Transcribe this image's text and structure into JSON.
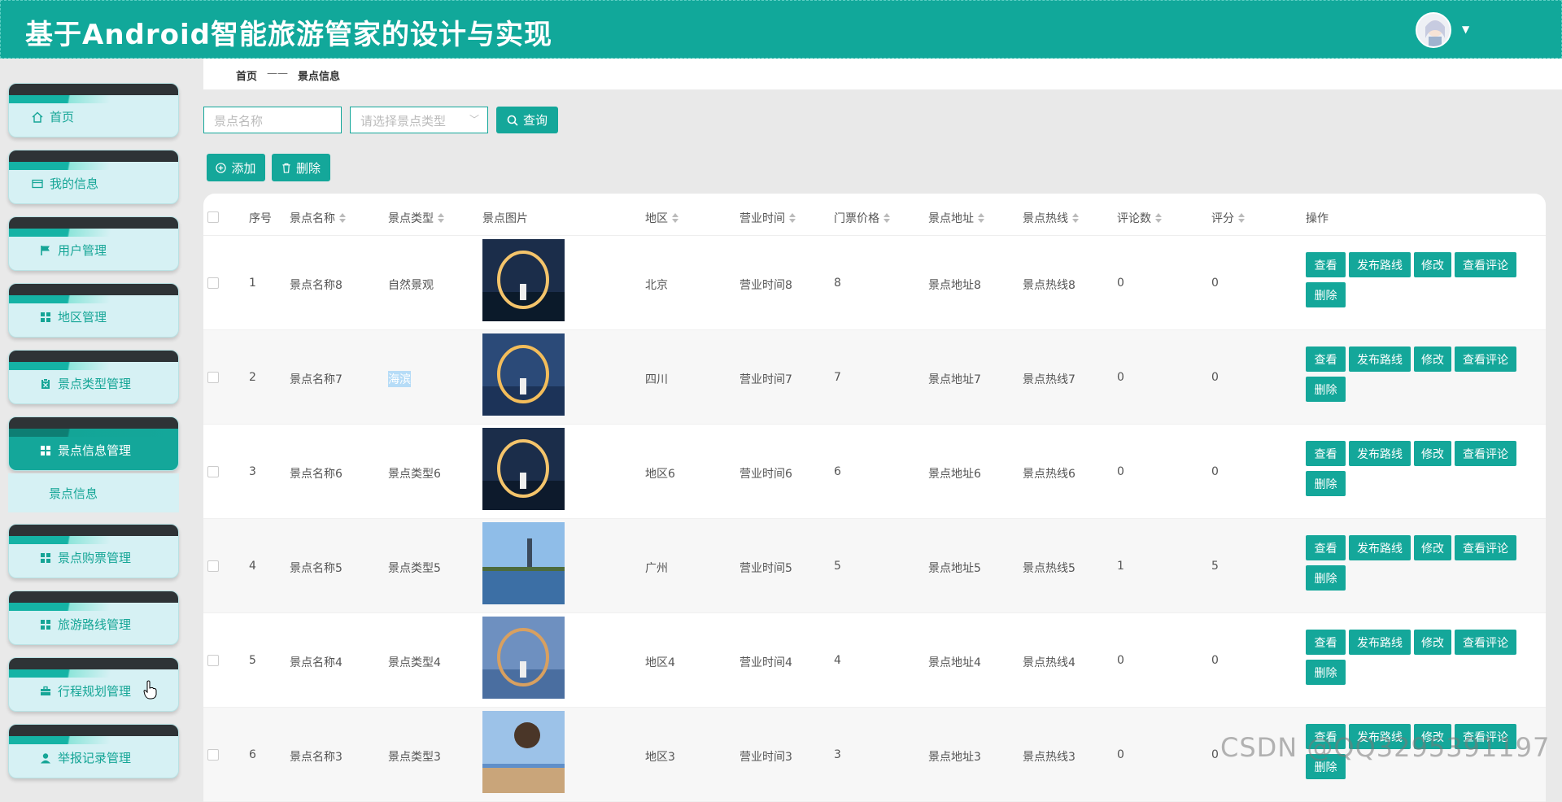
{
  "app": {
    "title": "基于Android智能旅游管家的设计与实现"
  },
  "sidebar": {
    "items": [
      {
        "label": "首页",
        "icon": "home-icon"
      },
      {
        "label": "我的信息",
        "icon": "card-icon"
      },
      {
        "label": "用户管理",
        "icon": "flag-icon"
      },
      {
        "label": "地区管理",
        "icon": "grid-icon"
      },
      {
        "label": "景点类型管理",
        "icon": "clipboard-icon"
      },
      {
        "label": "景点信息管理",
        "icon": "grid-icon"
      },
      {
        "label": "景点购票管理",
        "icon": "grid-icon"
      },
      {
        "label": "旅游路线管理",
        "icon": "grid-icon"
      },
      {
        "label": "行程规划管理",
        "icon": "briefcase-icon"
      },
      {
        "label": "举报记录管理",
        "icon": "user-icon"
      }
    ],
    "sub_item": "景点信息"
  },
  "breadcrumb": {
    "home": "首页",
    "sep": "——",
    "current": "景点信息"
  },
  "search": {
    "name_placeholder": "景点名称",
    "type_placeholder": "请选择景点类型",
    "query_label": "查询"
  },
  "toolbar": {
    "add_label": "添加",
    "delete_label": "删除"
  },
  "table": {
    "headers": [
      "序号",
      "景点名称",
      "景点类型",
      "景点图片",
      "地区",
      "营业时间",
      "门票价格",
      "景点地址",
      "景点热线",
      "评论数",
      "评分",
      "操作"
    ],
    "actions": [
      "查看",
      "发布路线",
      "修改",
      "查看评论",
      "删除"
    ],
    "rows": [
      {
        "no": "1",
        "name": "景点名称8",
        "type": "自然景观",
        "region": "北京",
        "hours": "营业时间8",
        "price": "8",
        "address": "景点地址8",
        "hotline": "景点热线8",
        "comments": "0",
        "score": "0"
      },
      {
        "no": "2",
        "name": "景点名称7",
        "type": "海滨",
        "region": "四川",
        "hours": "营业时间7",
        "price": "7",
        "address": "景点地址7",
        "hotline": "景点热线7",
        "comments": "0",
        "score": "0"
      },
      {
        "no": "3",
        "name": "景点名称6",
        "type": "景点类型6",
        "region": "地区6",
        "hours": "营业时间6",
        "price": "6",
        "address": "景点地址6",
        "hotline": "景点热线6",
        "comments": "0",
        "score": "0"
      },
      {
        "no": "4",
        "name": "景点名称5",
        "type": "景点类型5",
        "region": "广州",
        "hours": "营业时间5",
        "price": "5",
        "address": "景点地址5",
        "hotline": "景点热线5",
        "comments": "1",
        "score": "5"
      },
      {
        "no": "5",
        "name": "景点名称4",
        "type": "景点类型4",
        "region": "地区4",
        "hours": "营业时间4",
        "price": "4",
        "address": "景点地址4",
        "hotline": "景点热线4",
        "comments": "0",
        "score": "0"
      },
      {
        "no": "6",
        "name": "景点名称3",
        "type": "景点类型3",
        "region": "地区3",
        "hours": "营业时间3",
        "price": "3",
        "address": "景点地址3",
        "hotline": "景点热线3",
        "comments": "0",
        "score": "0"
      }
    ]
  },
  "watermark": "CSDN @QQ3295391197",
  "colors": {
    "accent": "#14a79a",
    "header": "#11a89a",
    "menu_bg": "#d6f1f4",
    "dark_band": "#2e3336"
  }
}
